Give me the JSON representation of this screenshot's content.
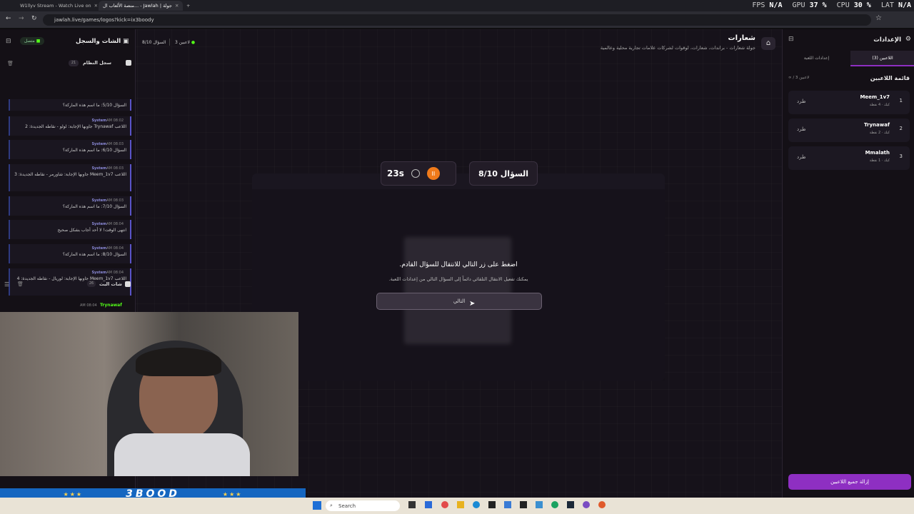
{
  "browser": {
    "tabs": [
      {
        "label": "W1llyv Stream - Watch Live on"
      },
      {
        "label": "منصة الألعاب ال... - Jawlah | جولة"
      }
    ],
    "url": "jawlah.live/games/logos?kick=ix3boody"
  },
  "hud": {
    "fps_label": "FPS",
    "fps": "N/A",
    "gpu_label": "GPU",
    "gpu": "37 %",
    "cpu_label": "CPU",
    "cpu": "30 %",
    "lat_label": "LAT",
    "lat": "N/A"
  },
  "left_sidebar": {
    "title": "الشات والسجل",
    "status": "متصل",
    "log_title": "سجل النظام",
    "log_count": "21",
    "logs": [
      {
        "sender": "",
        "time": "",
        "text": "السؤال 5/10: ما اسم هذه الماركة؟"
      },
      {
        "sender": "System",
        "time": "AM 08:02",
        "text": "اللاعب Trynawaf جاوبها الإجابة: لولو - نقاطه الجديدة: 2"
      },
      {
        "sender": "System",
        "time": "AM 08:03",
        "text": "السؤال 6/10: ما اسم هذه الماركة؟"
      },
      {
        "sender": "System",
        "time": "AM 08:03",
        "text": "اللاعب Meem_1v7 جاوبها الإجابة: شاورمر - نقاطه الجديدة: 3"
      },
      {
        "sender": "System",
        "time": "AM 08:03",
        "text": "السؤال 7/10: ما اسم هذه الماركة؟"
      },
      {
        "sender": "System",
        "time": "AM 08:04",
        "text": "انتهى الوقت! لا أحد أجاب بشكل صحيح"
      },
      {
        "sender": "System",
        "time": "AM 08:04",
        "text": "السؤال 8/10: ما اسم هذه الماركة؟"
      },
      {
        "sender": "System",
        "time": "AM 08:04",
        "text": "اللاعب Meem_1v7 جاوبها الإجابة: لوريال - نقاطه الجديدة: 4"
      }
    ],
    "chat_title": "شات البث",
    "chat_count": "26",
    "chat_user": "Trynawaf",
    "chat_time": "AM 08:04"
  },
  "main": {
    "players_count": "3 لاعبين",
    "question_short": "السؤال 8/10",
    "title": "شعارات",
    "subtitle": "جولة شعارات - براندات، شعارات، لوقوات لشركات علامات تجارية محلية وعالمية",
    "question_badge": "السؤال 8/10",
    "timer": "23s",
    "pause_glyph": "II",
    "next_prompt": "اضغط على زر التالي للانتقال للسؤال القادم.",
    "next_hint": "يمكنك تفعيل الانتقال التلقائي دائماً إلى السؤال التالي من إعدادات اللعبة.",
    "next_button": "التالي"
  },
  "right_sidebar": {
    "title": "الإعدادات",
    "tab_players": "اللاعبين (3)",
    "tab_settings": "إعدادات اللعبة",
    "list_title": "قائمة اللاعبين",
    "list_count": "∞ / 3 لاعبين",
    "players": [
      {
        "rank": "1",
        "name": "Meem_1v7",
        "score": "كيك · 4 نقطة",
        "kick": "طرد"
      },
      {
        "rank": "2",
        "name": "Trynawaf",
        "score": "كيك · 2 نقطة",
        "kick": "طرد"
      },
      {
        "rank": "3",
        "name": "Mmalath",
        "score": "كيك · 1 نقطة",
        "kick": "طرد"
      }
    ],
    "remove_all": "إزالة جميع اللاعبين"
  },
  "overlay": {
    "banner": "3BOOD"
  },
  "taskbar": {
    "search": "Search"
  },
  "colors": {
    "accent": "#8e2fc2",
    "timer_pause": "#f07a1a",
    "log_accent": "#5a54c9",
    "kick_green": "#53fc18"
  }
}
